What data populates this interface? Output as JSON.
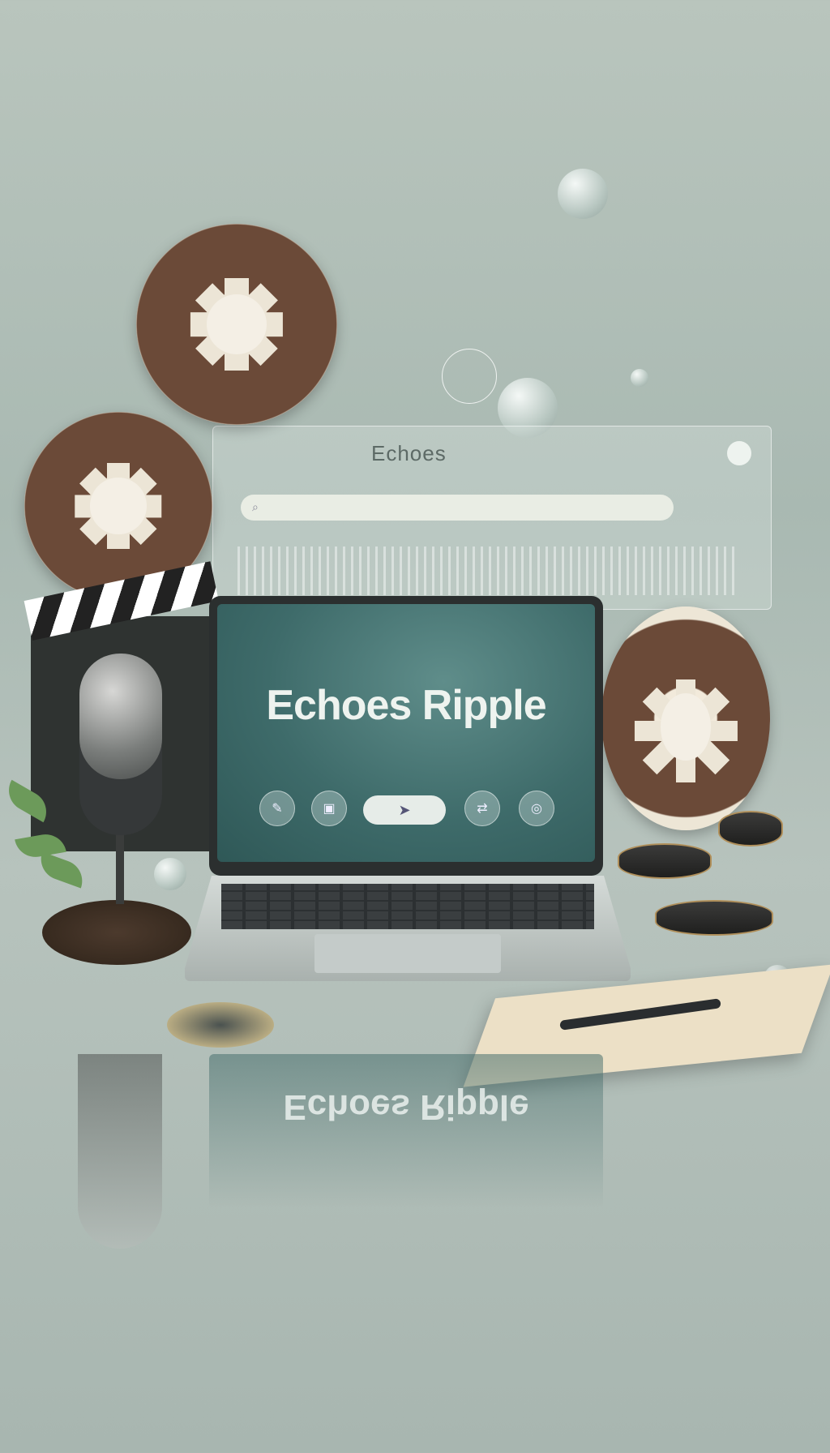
{
  "panel": {
    "title": "Echoes"
  },
  "screen": {
    "title": "Echoes Ripple",
    "reflection_text": "Echoes Ripple"
  },
  "icons": {
    "reel": "film-reel-icon",
    "mic": "microphone-icon",
    "clapper": "clapperboard-icon",
    "search": "search-icon"
  },
  "colors": {
    "background": "#b3c2bb",
    "screen": "#3e6b6a",
    "reel_brown": "#6b4a38"
  }
}
